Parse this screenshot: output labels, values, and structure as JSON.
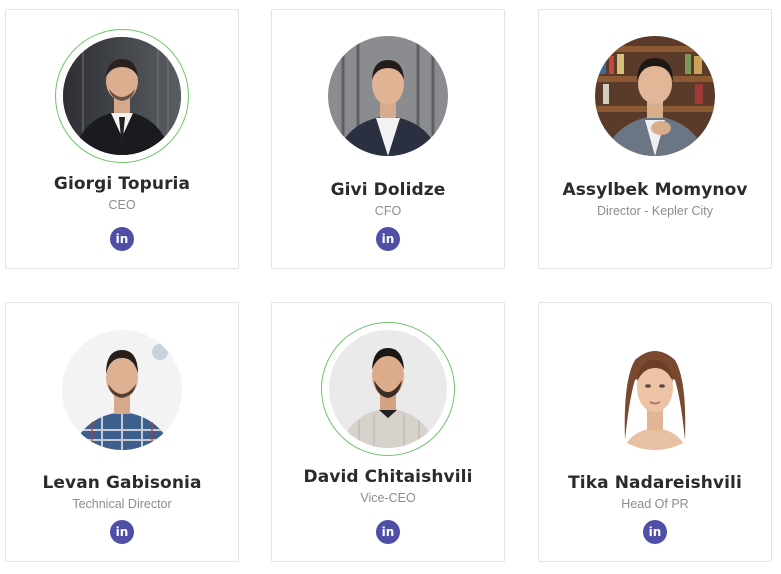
{
  "team": [
    {
      "name": "Giorgi Topuria",
      "role": "CEO",
      "linkedin_label": "in"
    },
    {
      "name": "Givi Dolidze",
      "role": "CFO",
      "linkedin_label": "in"
    },
    {
      "name": "Assylbek Momynov",
      "role": "Director - Kepler City",
      "linkedin_label": "in"
    },
    {
      "name": "Levan Gabisonia",
      "role": "Technical Director",
      "linkedin_label": "in"
    },
    {
      "name": "David Chitaishvili",
      "role": "Vice-CEO",
      "linkedin_label": "in"
    },
    {
      "name": "Tika Nadareishvili",
      "role": "Head Of PR",
      "linkedin_label": "in"
    }
  ],
  "colors": {
    "linkedin_badge": "#4f4fa8",
    "ring": "#6fc46a",
    "name_text": "#2b2b2b",
    "role_text": "#8c8c8c"
  }
}
